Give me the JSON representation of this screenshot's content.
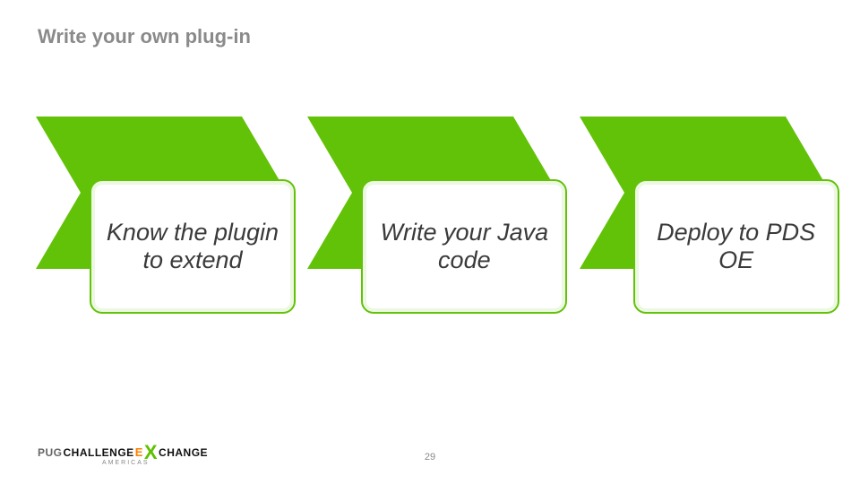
{
  "title": "Write your own plug-in",
  "steps": [
    {
      "label": "Know the plugin to extend"
    },
    {
      "label": "Write your Java code"
    },
    {
      "label": "Deploy to PDS OE"
    }
  ],
  "page_number": "29",
  "footer": {
    "logo_pug": "PUG",
    "logo_challenge": "CHALLENGE",
    "logo_e": "E",
    "logo_x": "X",
    "logo_change": "CHANGE",
    "logo_sub": "AMERICAS"
  },
  "colors": {
    "accent": "#62c208"
  }
}
